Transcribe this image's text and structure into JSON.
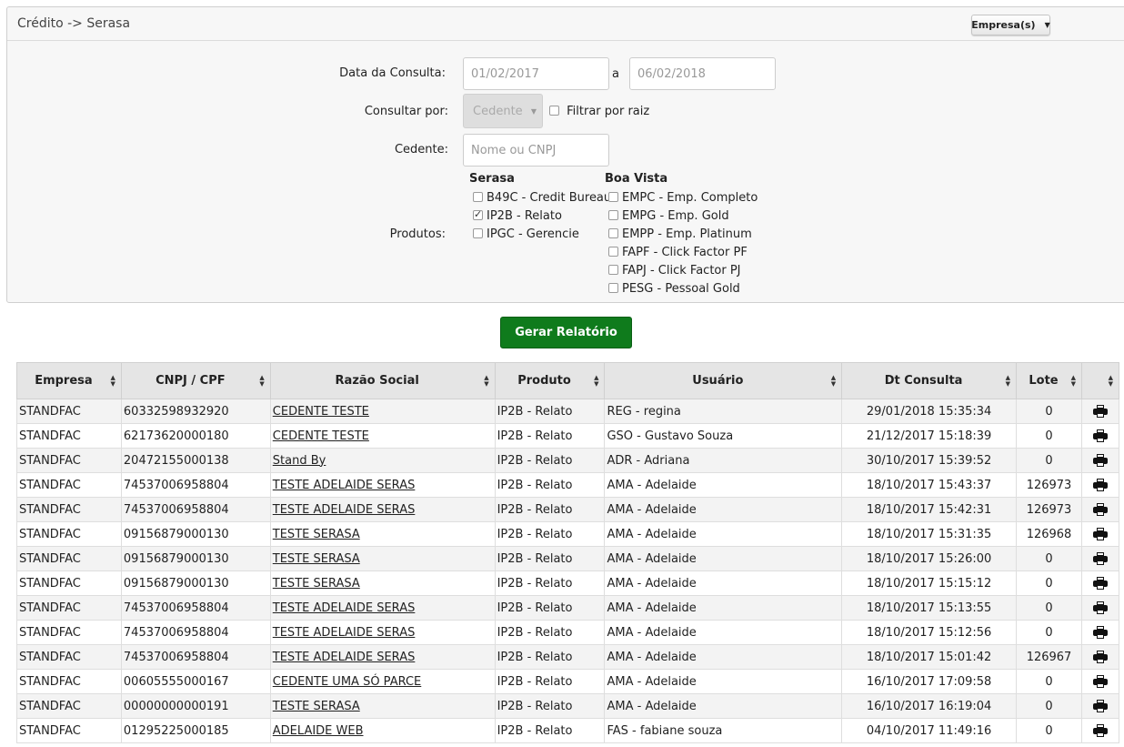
{
  "header": {
    "title": "Crédito -> Serasa",
    "empresas_label": "Empresa(s)"
  },
  "form": {
    "data_label": "Data da Consulta:",
    "date_from": "01/02/2017",
    "date_sep": "a",
    "date_to": "06/02/2018",
    "consultar_label": "Consultar por:",
    "consultar_value": "Cedente",
    "filtrar_raiz_label": "Filtrar por raiz",
    "cedente_label": "Cedente:",
    "cedente_placeholder": "Nome ou CNPJ",
    "produtos_label": "Produtos:",
    "serasa_title": "Serasa",
    "boavista_title": "Boa Vista",
    "serasa_items": [
      {
        "label": "B49C - Credit Bureau",
        "checked": false
      },
      {
        "label": "IP2B - Relato",
        "checked": true
      },
      {
        "label": "IPGC - Gerencie",
        "checked": false
      }
    ],
    "boavista_items": [
      {
        "label": "EMPC - Emp. Completo",
        "checked": false
      },
      {
        "label": "EMPG - Emp. Gold",
        "checked": false
      },
      {
        "label": "EMPP - Emp. Platinum",
        "checked": false
      },
      {
        "label": "FAPF - Click Factor PF",
        "checked": false
      },
      {
        "label": "FAPJ - Click Factor PJ",
        "checked": false
      },
      {
        "label": "PESG - Pessoal Gold",
        "checked": false
      }
    ],
    "gerar_label": "Gerar Relatório"
  },
  "table": {
    "headers": [
      "Empresa",
      "CNPJ / CPF",
      "Razão Social",
      "Produto",
      "Usuário",
      "Dt Consulta",
      "Lote",
      ""
    ],
    "rows": [
      [
        "STANDFAC",
        "60332598932920",
        "CEDENTE TESTE",
        "IP2B - Relato",
        "REG - regina",
        "29/01/2018 15:35:34",
        "0"
      ],
      [
        "STANDFAC",
        "62173620000180",
        "CEDENTE TESTE",
        "IP2B - Relato",
        "GSO - Gustavo Souza",
        "21/12/2017 15:18:39",
        "0"
      ],
      [
        "STANDFAC",
        "20472155000138",
        "Stand By",
        "IP2B - Relato",
        "ADR - Adriana",
        "30/10/2017 15:39:52",
        "0"
      ],
      [
        "STANDFAC",
        "74537006958804",
        "TESTE ADELAIDE SERAS",
        "IP2B - Relato",
        "AMA - Adelaide",
        "18/10/2017 15:43:37",
        "126973"
      ],
      [
        "STANDFAC",
        "74537006958804",
        "TESTE ADELAIDE SERAS",
        "IP2B - Relato",
        "AMA - Adelaide",
        "18/10/2017 15:42:31",
        "126973"
      ],
      [
        "STANDFAC",
        "09156879000130",
        "TESTE SERASA",
        "IP2B - Relato",
        "AMA - Adelaide",
        "18/10/2017 15:31:35",
        "126968"
      ],
      [
        "STANDFAC",
        "09156879000130",
        "TESTE SERASA",
        "IP2B - Relato",
        "AMA - Adelaide",
        "18/10/2017 15:26:00",
        "0"
      ],
      [
        "STANDFAC",
        "09156879000130",
        "TESTE SERASA",
        "IP2B - Relato",
        "AMA - Adelaide",
        "18/10/2017 15:15:12",
        "0"
      ],
      [
        "STANDFAC",
        "74537006958804",
        "TESTE ADELAIDE SERAS",
        "IP2B - Relato",
        "AMA - Adelaide",
        "18/10/2017 15:13:55",
        "0"
      ],
      [
        "STANDFAC",
        "74537006958804",
        "TESTE ADELAIDE SERAS",
        "IP2B - Relato",
        "AMA - Adelaide",
        "18/10/2017 15:12:56",
        "0"
      ],
      [
        "STANDFAC",
        "74537006958804",
        "TESTE ADELAIDE SERAS",
        "IP2B - Relato",
        "AMA - Adelaide",
        "18/10/2017 15:01:42",
        "126967"
      ],
      [
        "STANDFAC",
        "00605555000167",
        "CEDENTE UMA SÓ PARCE",
        "IP2B - Relato",
        "AMA - Adelaide",
        "16/10/2017 17:09:58",
        "0"
      ],
      [
        "STANDFAC",
        "00000000000191",
        "TESTE SERASA",
        "IP2B - Relato",
        "AMA - Adelaide",
        "16/10/2017 16:19:04",
        "0"
      ],
      [
        "STANDFAC",
        "01295225000185",
        "ADELAIDE WEB",
        "IP2B - Relato",
        "FAS - fabiane souza",
        "04/10/2017 11:49:16",
        "0"
      ]
    ]
  }
}
